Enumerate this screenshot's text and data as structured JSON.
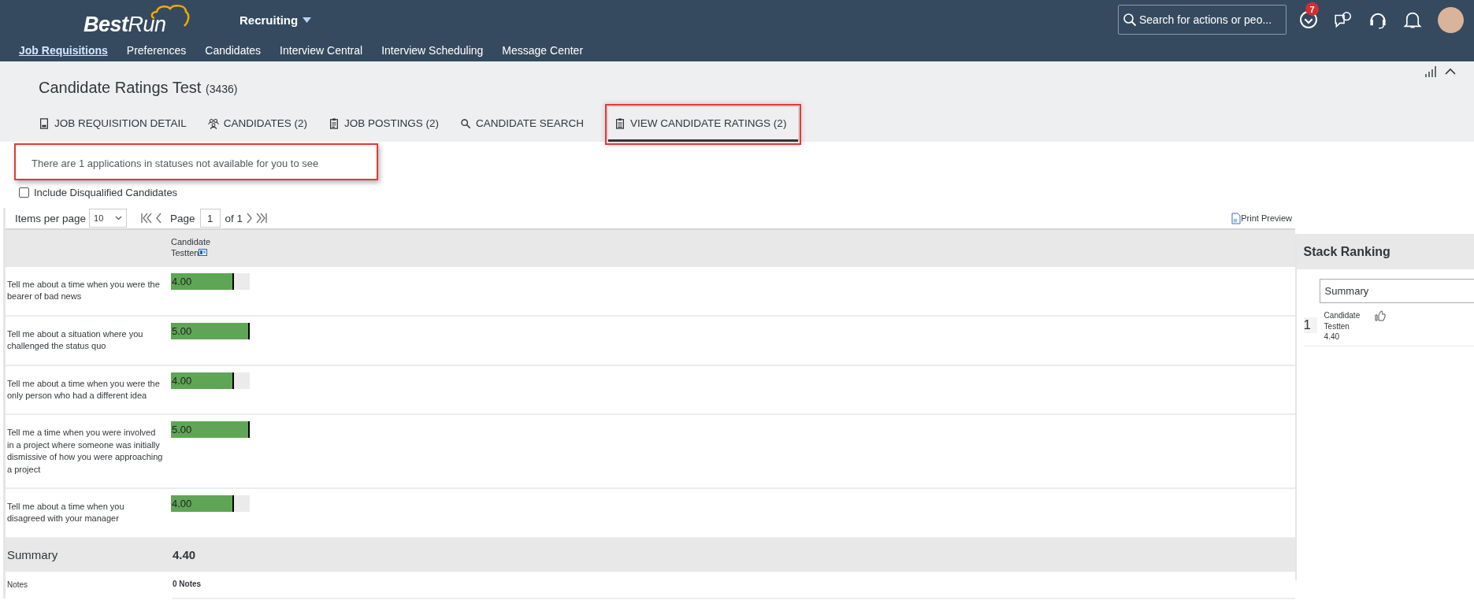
{
  "header": {
    "logo": "**Best**Run",
    "module": "Recruiting",
    "search": {
      "placeholder": "Search for actions or peo..."
    },
    "notification_badge": "7"
  },
  "nav": [
    {
      "label": "Job Requisitions",
      "selected": true
    },
    {
      "label": "Preferences",
      "selected": false
    },
    {
      "label": "Candidates",
      "selected": false
    },
    {
      "label": "Interview Central",
      "selected": false
    },
    {
      "label": "Interview Scheduling",
      "selected": false
    },
    {
      "label": "Message Center",
      "selected": false
    }
  ],
  "page": {
    "title": "Candidate Ratings Test",
    "count": "(3436)"
  },
  "tabs": [
    {
      "label": "JOB REQUISITION DETAIL",
      "selected": false,
      "highlighted": false
    },
    {
      "label": "CANDIDATES (2)",
      "selected": false,
      "highlighted": false
    },
    {
      "label": "JOB POSTINGS (2)",
      "selected": false,
      "highlighted": false
    },
    {
      "label": "CANDIDATE SEARCH",
      "selected": false,
      "highlighted": false
    },
    {
      "label": "VIEW CANDIDATE RATINGS (2)",
      "selected": true,
      "highlighted": true
    }
  ],
  "notice": {
    "text": "There are 1 applications in statuses not available for you to see",
    "highlighted": true
  },
  "include_disqualified": {
    "label": "Include Disqualified Candidates",
    "checked": false
  },
  "pagination": {
    "items_label": "Items per page",
    "items_value": "10",
    "page_label": "Page",
    "page_value": "1",
    "of_label": "of 1"
  },
  "print_preview": "Print Preview",
  "ratings": {
    "candidate": "Candidate Testten",
    "rows": [
      {
        "question": "Tell me about a time when you were the bearer of bad news",
        "score": "4.00",
        "level": 0.8
      },
      {
        "question": "Tell me about a situation where you challenged the status quo",
        "score": "5.00",
        "level": 1
      },
      {
        "question": "Tell me about a time when you were the only person who had a different idea",
        "score": "4.00",
        "level": 0.8
      },
      {
        "question": "Tell me a time when you were involved in a project where someone was initially dismissive of how you were approaching a project",
        "score": "5.00",
        "level": 1
      },
      {
        "question": "Tell me about a time when you disagreed with your manager",
        "score": "4.00",
        "level": 0.8
      }
    ],
    "summary": {
      "label": "Summary",
      "value": "4.40"
    },
    "notes": {
      "label": "Notes",
      "value": "0 Notes"
    }
  },
  "stack_ranking": {
    "title": "Stack Ranking",
    "select": "Summary",
    "items": [
      {
        "rank": "1",
        "name": "Candidate Testten",
        "score": "4.40"
      }
    ]
  }
}
